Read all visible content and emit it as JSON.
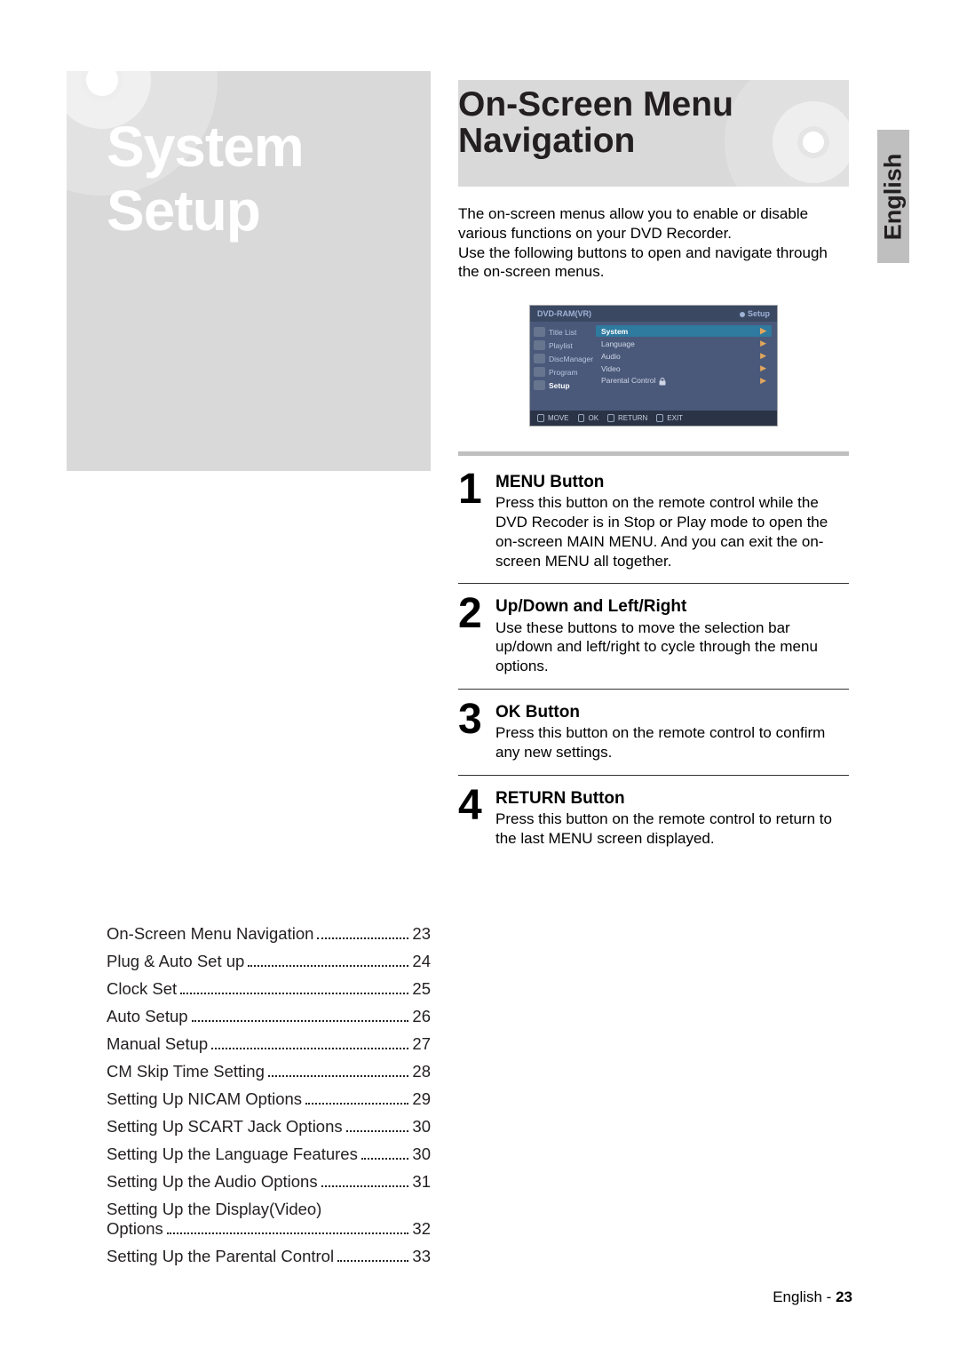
{
  "left_title_line1": "System",
  "left_title_line2": "Setup",
  "toc": [
    {
      "label": "On-Screen Menu Navigation",
      "page": "23"
    },
    {
      "label": "Plug & Auto Set up",
      "page": "24"
    },
    {
      "label": "Clock Set",
      "page": "25"
    },
    {
      "label": "Auto Setup",
      "page": "26"
    },
    {
      "label": "Manual Setup",
      "page": "27"
    },
    {
      "label": "CM Skip Time Setting",
      "page": "28"
    },
    {
      "label": "Setting Up NICAM Options",
      "page": "29"
    },
    {
      "label": "Setting Up SCART Jack Options",
      "page": "30"
    },
    {
      "label": "Setting Up the Language Features",
      "page": "30"
    },
    {
      "label": "Setting Up the Audio Options",
      "page": "31"
    },
    {
      "label": "Setting Up the Display(Video) Options",
      "page": "32"
    },
    {
      "label": "Setting Up the Parental Control",
      "page": "33"
    }
  ],
  "right": {
    "heading_l1": "On-Screen Menu",
    "heading_l2": "Navigation",
    "intro": "The on-screen menus allow you to enable or disable various functions on your DVD Recorder.\nUse the following buttons to open and navigate through the on-screen menus."
  },
  "ui": {
    "top_left": "DVD-RAM(VR)",
    "top_right": "Setup",
    "side": [
      "Title List",
      "Playlist",
      "DiscManager",
      "Program",
      "Setup"
    ],
    "side_selected": 4,
    "menu": [
      "System",
      "Language",
      "Audio",
      "Video",
      "Parental Control"
    ],
    "menu_hl": 0,
    "bottom": [
      "MOVE",
      "OK",
      "RETURN",
      "EXIT"
    ]
  },
  "steps": [
    {
      "n": "1",
      "title": "MENU Button",
      "body": "Press this button on the remote control while the DVD Recoder is in Stop or Play mode to open the on-screen MAIN MENU. And you can exit the on-screen MENU all together."
    },
    {
      "n": "2",
      "title": "Up/Down and Left/Right",
      "body": "Use these buttons to move the selection bar up/down and left/right to cycle through the menu options."
    },
    {
      "n": "3",
      "title": "OK Button",
      "body": "Press this button on the remote control to confirm any new settings."
    },
    {
      "n": "4",
      "title": "RETURN Button",
      "body": "Press this button on the remote control to return to the last MENU screen displayed."
    }
  ],
  "lang_tab": "English",
  "footer": {
    "lang": "English - ",
    "page": "23"
  }
}
